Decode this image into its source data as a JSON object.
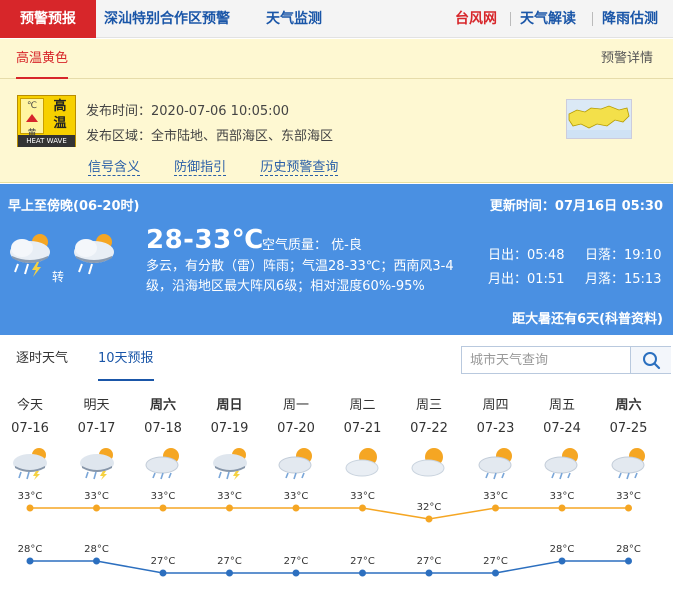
{
  "nav": {
    "items": [
      {
        "label": "预警预报",
        "active": true
      },
      {
        "label": "深汕特别合作区预警"
      },
      {
        "label": "天气监测"
      },
      {
        "label": "台风网",
        "highlight": true
      },
      {
        "label": "天气解读"
      },
      {
        "label": "降雨估测"
      }
    ]
  },
  "warning": {
    "tab": "高温黄色",
    "detail_link": "预警详情",
    "icon": {
      "unit": "℃",
      "level": "黄",
      "title1": "高",
      "title2": "温",
      "caption": "HEAT WAVE",
      "color": "#f7d000"
    },
    "publish_time": "发布时间：2020-07-06 10:05:00",
    "publish_area": "发布区域：全市陆地、西部海区、东部海区",
    "links": [
      "信号含义",
      "防御指引",
      "历史预警查询"
    ]
  },
  "today": {
    "period": "早上至傍晚(06-20时)",
    "update": "更新时间：07月16日 05:30",
    "turn": "转",
    "temp": "28-33℃",
    "air_quality": "空气质量： 优-良",
    "desc": "多云，有分散（雷）阵雨；气温28-33℃；西南风3-4级，沿海地区最大阵风6级；相对湿度60%-95%",
    "sunrise": "日出：05:48",
    "sunset": "日落：19:10",
    "moonrise": "月出：01:51",
    "moonset": "月落：15:13",
    "heat": "距大暑还有6天(科普资料)",
    "bg_color": "#4a90e2"
  },
  "forecast": {
    "tabs": [
      {
        "label": "逐时天气"
      },
      {
        "label": "10天预报",
        "active": true
      }
    ],
    "search_placeholder": "城市天气查询",
    "high_color": "#f5a623",
    "low_color": "#2c6fbf",
    "days": [
      {
        "name": "今天",
        "date": "07-16",
        "icon": "thunder-rain-icon",
        "high": 33,
        "low": 28,
        "bold": false
      },
      {
        "name": "明天",
        "date": "07-17",
        "icon": "thunder-rain-icon",
        "high": 33,
        "low": 28,
        "bold": false
      },
      {
        "name": "周六",
        "date": "07-18",
        "icon": "partly-cloudy-rain-icon",
        "high": 33,
        "low": 27,
        "bold": true
      },
      {
        "name": "周日",
        "date": "07-19",
        "icon": "thunder-rain-icon",
        "high": 33,
        "low": 27,
        "bold": true
      },
      {
        "name": "周一",
        "date": "07-20",
        "icon": "partly-cloudy-rain-icon",
        "high": 33,
        "low": 27,
        "bold": false
      },
      {
        "name": "周二",
        "date": "07-21",
        "icon": "sun-cloud-icon",
        "high": 33,
        "low": 27,
        "bold": false
      },
      {
        "name": "周三",
        "date": "07-22",
        "icon": "sun-cloud-icon",
        "high": 32,
        "low": 27,
        "bold": false
      },
      {
        "name": "周四",
        "date": "07-23",
        "icon": "partly-cloudy-rain-icon",
        "high": 33,
        "low": 27,
        "bold": false
      },
      {
        "name": "周五",
        "date": "07-24",
        "icon": "partly-cloudy-rain-icon",
        "high": 33,
        "low": 28,
        "bold": false
      },
      {
        "name": "周六",
        "date": "07-25",
        "icon": "partly-cloudy-rain-icon",
        "high": 33,
        "low": 28,
        "bold": true
      }
    ],
    "unit": "°C"
  }
}
